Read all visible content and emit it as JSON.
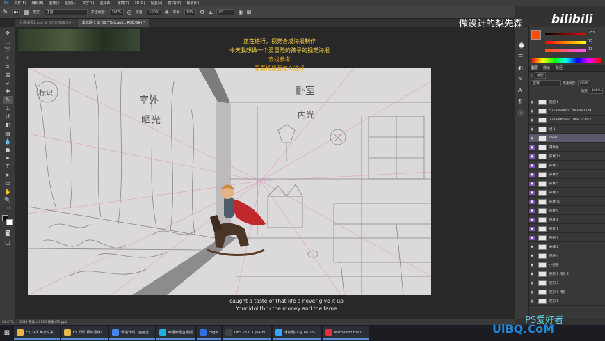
{
  "menu": [
    "文件(F)",
    "编辑(E)",
    "图像(I)",
    "图层(L)",
    "文字(Y)",
    "选择(S)",
    "滤镜(T)",
    "3D(D)",
    "视图(V)",
    "窗口(W)",
    "帮助(H)"
  ],
  "options": {
    "mode_label": "模式:",
    "mode_value": "正常",
    "opacity_label": "不透明度:",
    "opacity_value": "100%",
    "flow_label": "流量:",
    "flow_value": "100%",
    "smooth_label": "平滑:",
    "smooth_value": "10%",
    "angle_value": "0°"
  },
  "tabs": [
    {
      "label": "合成海报1.psd @ 50%(RGB/8#)"
    },
    {
      "label": "未标题-1 @ 66.7% (caotu, RGB/8#) *"
    }
  ],
  "overlay": {
    "line1": "正在进行，视觉合成海报制作",
    "line2": "今天我想做一个爱冒险的孩子的视觉海报",
    "line3": "去找参考",
    "line4": "看看场景要怎么选择"
  },
  "subtitles": {
    "line1": "caught a taste of that life a never give it up",
    "line2": "Your idol thru the money and the fame"
  },
  "status": {
    "zoom": "66.67%",
    "docsize": "2844 像素 x 2169 像素 (72 ppi)"
  },
  "color_panel": {
    "r": "255",
    "g": "75",
    "b": "13"
  },
  "layers_panel": {
    "tabs": [
      "图层",
      "通道",
      "路径"
    ],
    "kind_label": "类型",
    "blend_value": "正常",
    "opacity_label": "不透明度:",
    "opacity_value": "100%",
    "fill_label": "填充:",
    "fill_value": "100%"
  },
  "layers": [
    {
      "name": "图层 6",
      "purple": false,
      "selected": false
    },
    {
      "name": "575abb49b1...563f4e7379",
      "purple": false,
      "selected": false
    },
    {
      "name": "228ed9fbbbc...0fac7426c6",
      "purple": false,
      "selected": false
    },
    {
      "name": "组 1",
      "purple": false,
      "selected": false
    },
    {
      "name": "caotu",
      "purple": false,
      "selected": true
    },
    {
      "name": "辅助线",
      "purple": true,
      "selected": false
    },
    {
      "name": "形状 14",
      "purple": true,
      "selected": false
    },
    {
      "name": "形状 7",
      "purple": true,
      "selected": false
    },
    {
      "name": "形状 6",
      "purple": true,
      "selected": false
    },
    {
      "name": "形状 5",
      "purple": true,
      "selected": false
    },
    {
      "name": "形状 4",
      "purple": true,
      "selected": false
    },
    {
      "name": "形状 10",
      "purple": true,
      "selected": false
    },
    {
      "name": "形状 9",
      "purple": true,
      "selected": false
    },
    {
      "name": "形状 8",
      "purple": true,
      "selected": false
    },
    {
      "name": "形状 1",
      "purple": true,
      "selected": false
    },
    {
      "name": "图层 7",
      "purple": true,
      "selected": false
    },
    {
      "name": "曲线 2",
      "purple": false,
      "selected": false
    },
    {
      "name": "图层 4",
      "purple": false,
      "selected": false
    },
    {
      "name": "小男孩",
      "purple": false,
      "selected": false
    },
    {
      "name": "矩形 1 拷贝 2",
      "purple": false,
      "selected": false
    },
    {
      "name": "矩形 2",
      "purple": false,
      "selected": false
    },
    {
      "name": "矩形 1 拷贝",
      "purple": false,
      "selected": false
    },
    {
      "name": "矩形 1",
      "purple": false,
      "selected": false
    }
  ],
  "taskbar": [
    {
      "label": "E:\\【A】每日文字...",
      "color": "#e8b84a"
    },
    {
      "label": "E:\\【B】照片素材\\...",
      "color": "#e8b84a"
    },
    {
      "label": "做设计吗，画画觉...",
      "color": "#4285f4"
    },
    {
      "label": "哔哩哔哩直播姬",
      "color": "#23ade5"
    },
    {
      "label": "Eagle",
      "color": "#2f6fe0"
    },
    {
      "label": "OBS 25.0.1 (64-bi...",
      "color": "#444444"
    },
    {
      "label": "未标题-1 @ 66.7%...",
      "color": "#31a8ff"
    },
    {
      "label": "Married to the G...",
      "color": "#e0323c"
    }
  ],
  "sketch_labels": {
    "outdoor": "室外",
    "sunlight": "晒光",
    "bedroom": "卧室",
    "inner_light": "内光",
    "sign": "标识"
  },
  "watermarks": {
    "top": "做设计的梨先森",
    "bili": "bilibili",
    "bottom": "PS爱好者",
    "url": "UiBQ.CoM"
  }
}
